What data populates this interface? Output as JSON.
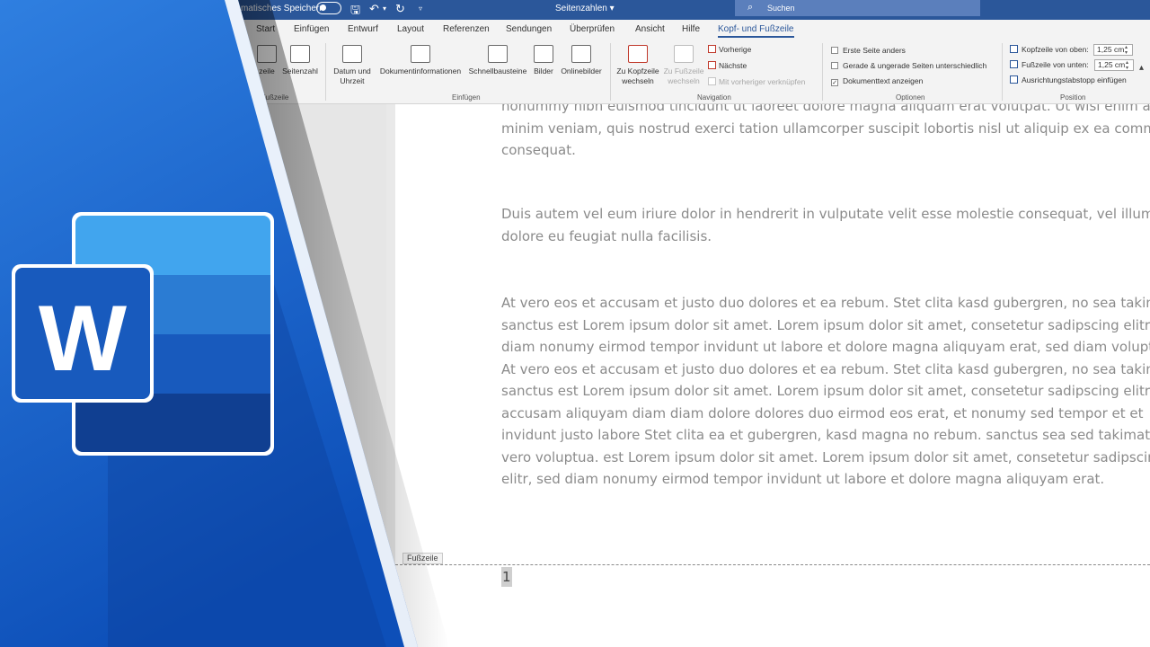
{
  "titlebar": {
    "autosave_label": "matisches Speichern",
    "doc_title": "Seitenzahlen ▾",
    "search_placeholder": "Suchen"
  },
  "tabs": [
    "Start",
    "Einfügen",
    "Entwurf",
    "Layout",
    "Referenzen",
    "Sendungen",
    "Überprüfen",
    "Ansicht",
    "Hilfe",
    "Kopf- und Fußzeile"
  ],
  "ribbon": {
    "partial_left": "zeile",
    "partial_left_group": "d Fußzeile",
    "seitenzahl": "Seitenzahl",
    "datum_1": "Datum und",
    "datum_2": "Uhrzeit",
    "dokinfo": "Dokumentinformationen",
    "schnell": "Schnellbausteine",
    "bilder": "Bilder",
    "online": "Onlinebilder",
    "group_einfuegen": "Einfügen",
    "kopf_1": "Zu Kopfzeile",
    "kopf_2": "wechseln",
    "fuss_1": "Zu Fußzeile",
    "fuss_2": "wechseln",
    "vorherige": "Vorherige",
    "naechste": "Nächste",
    "verknuepfen": "Mit vorheriger verknüpfen",
    "group_navigation": "Navigation",
    "opt_erste": "Erste Seite anders",
    "opt_gerade": "Gerade & ungerade Seiten unterschiedlich",
    "opt_dok": "Dokumenttext anzeigen",
    "group_optionen": "Optionen",
    "kopf_oben": "Kopfzeile von oben:",
    "kopf_oben_val": "1,25 cm",
    "fuss_unten": "Fußzeile von unten:",
    "fuss_unten_val": "1,25 cm",
    "ausrichtung": "Ausrichtungstabstopp einfügen",
    "group_position": "Position"
  },
  "document": {
    "para1": [
      "nonummy nibh euismod tincidunt ut laoreet dolore magna aliquam erat volutpat. Ut wisi enim ad",
      "minim veniam, quis nostrud exerci tation ullamcorper suscipit lobortis nisl ut aliquip ex ea commodo",
      "consequat."
    ],
    "para2": [
      "Duis autem vel eum iriure dolor in hendrerit in vulputate velit esse molestie consequat, vel illum",
      "dolore eu feugiat nulla facilisis."
    ],
    "para3": [
      "At vero eos et accusam et justo duo dolores et ea rebum. Stet clita kasd gubergren, no sea takimata",
      "sanctus est Lorem ipsum dolor sit amet. Lorem ipsum dolor sit amet, consetetur sadipscing elitr, sed",
      "diam nonumy eirmod tempor invidunt ut labore et dolore magna aliquyam erat, sed diam voluptua.",
      "At vero eos et accusam et justo duo dolores et ea rebum. Stet clita kasd gubergren, no sea takimata",
      "sanctus est Lorem ipsum dolor sit amet. Lorem ipsum dolor sit amet, consetetur sadipscing elitr, At",
      "accusam aliquyam diam diam dolore dolores duo eirmod eos erat, et nonumy sed tempor et et",
      "invidunt justo labore Stet clita ea et gubergren, kasd magna no rebum. sanctus sea sed takimata ut",
      "vero voluptua. est Lorem ipsum dolor sit amet. Lorem ipsum dolor sit amet, consetetur sadipscing",
      "elitr, sed diam nonumy eirmod tempor invidunt ut labore et dolore magna aliquyam erat."
    ],
    "footer_tag": "Fußzeile",
    "page_number": "1"
  },
  "logo": {
    "letter": "W",
    "colors": {
      "top": "#41a5ee",
      "mid": "#2b7cd3",
      "low": "#185abd",
      "bottom": "#103f91",
      "badge": "#185abd"
    }
  }
}
